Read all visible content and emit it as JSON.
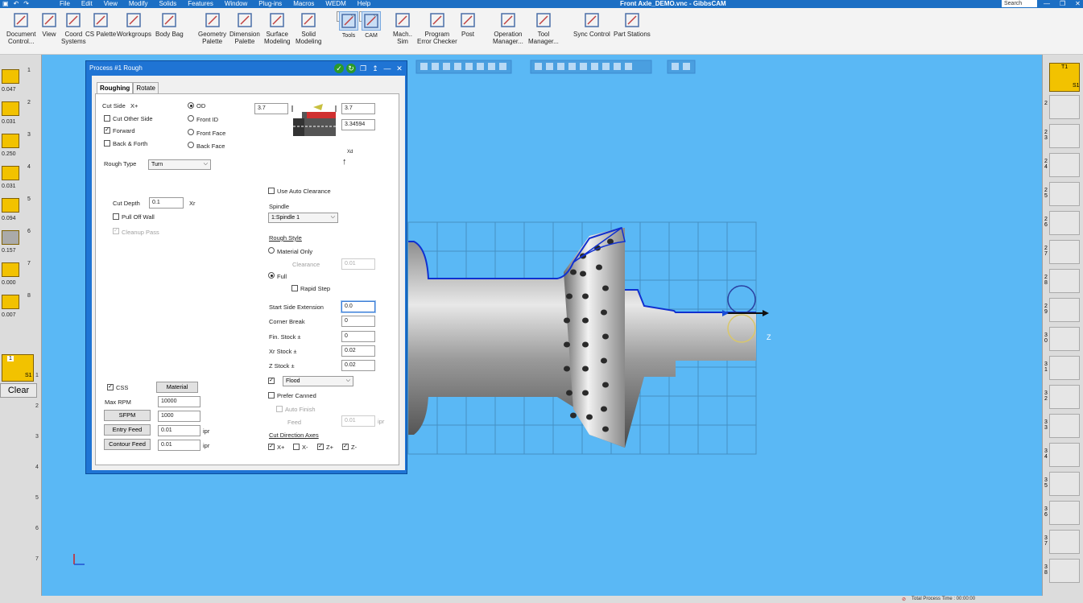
{
  "window": {
    "title": "Front Axle_DEMO.vnc - GibbsCAM",
    "search_placeholder": "Search",
    "menu": [
      "File",
      "Edit",
      "View",
      "Modify",
      "Solids",
      "Features",
      "Window",
      "Plug-ins",
      "Macros",
      "WEDM",
      "Help"
    ]
  },
  "ribbon": {
    "items": [
      {
        "label1": "Document",
        "label2": "Control...",
        "icon": "document-icon"
      },
      {
        "label1": "View",
        "label2": "",
        "icon": "view-icon"
      },
      {
        "label1": "Coord",
        "label2": "Systems",
        "icon": "coord-icon"
      },
      {
        "label1": "CS Palette",
        "label2": "",
        "icon": "cs-palette-icon"
      },
      {
        "label1": "Workgroups",
        "label2": "",
        "icon": "workgroups-icon"
      },
      {
        "label1": "Body Bag",
        "label2": "",
        "icon": "body-bag-icon"
      },
      {
        "label1": "Geometry",
        "label2": "Palette",
        "icon": "geometry-icon"
      },
      {
        "label1": "Dimension",
        "label2": "Palette",
        "icon": "dimension-icon"
      },
      {
        "label1": "Surface",
        "label2": "Modeling",
        "icon": "surface-icon"
      },
      {
        "label1": "Solid",
        "label2": "Modeling",
        "icon": "solid-icon"
      },
      {
        "label1": "Tools",
        "label2": "",
        "icon": "tools-icon"
      },
      {
        "label1": "CAM",
        "label2": "",
        "icon": "cam-icon"
      },
      {
        "label1": "Mach..",
        "label2": "Sim",
        "icon": "machine-sim-icon"
      },
      {
        "label1": "Program",
        "label2": "Error Checker",
        "icon": "check-icon"
      },
      {
        "label1": "Post",
        "label2": "",
        "icon": "post-icon"
      },
      {
        "label1": "Operation",
        "label2": "Manager...",
        "icon": "operation-icon"
      },
      {
        "label1": "Tool",
        "label2": "Manager...",
        "icon": "tool-manager-icon"
      },
      {
        "label1": "Sync Control",
        "label2": "",
        "icon": "sync-icon"
      },
      {
        "label1": "Part Stations",
        "label2": "",
        "icon": "part-stations-icon"
      }
    ]
  },
  "tool_list": {
    "tools": [
      {
        "index": "1",
        "value": "0.047"
      },
      {
        "index": "2",
        "value": "0.031"
      },
      {
        "index": "3",
        "value": "0.250"
      },
      {
        "index": "4",
        "value": "0.031"
      },
      {
        "index": "5",
        "value": "0.094"
      },
      {
        "index": "6",
        "value": "0.157"
      },
      {
        "index": "7",
        "value": "0.000"
      },
      {
        "index": "8",
        "value": "0.007"
      }
    ],
    "clear_label": "Clear",
    "process_tile": {
      "num": "1",
      "sub": "S1"
    },
    "process_slots": [
      "1",
      "2",
      "3",
      "4",
      "5",
      "6",
      "7"
    ]
  },
  "right_stations": {
    "tile_top": "T1",
    "tile_sub": "S1",
    "slots": [
      "2",
      "2 3",
      "2 4",
      "2 5",
      "2 6",
      "2 7",
      "2 8",
      "2 9",
      "3 0",
      "3 1",
      "3 2",
      "3 3",
      "3 4",
      "3 5",
      "3 6",
      "3 7",
      "3 8"
    ]
  },
  "dialog": {
    "title": "Process #1 Rough",
    "tabs": [
      "Roughing",
      "Rotate"
    ],
    "cut_side_label": "Cut Side",
    "cut_side_value": "X+",
    "cut_other_side": "Cut Other Side",
    "forward": "Forward",
    "back_forth": "Back & Forth",
    "od": "OD",
    "front_id": "Front ID",
    "front_face": "Front Face",
    "back_face": "Back Face",
    "dim_left": "3.7",
    "dim_right": "3.7",
    "dim_right2": "3.34594",
    "xd": "Xd",
    "rough_type_label": "Rough Type",
    "rough_type_value": "Turn",
    "use_auto_clearance": "Use Auto Clearance",
    "spindle_label": "Spindle",
    "spindle_value": "1:Spindle 1",
    "cut_depth_label": "Cut Depth",
    "cut_depth_value": "0.1",
    "cut_depth_unit": "Xr",
    "pull_off_wall": "Pull Off Wall",
    "cleanup_pass": "Cleanup Pass",
    "rough_style_label": "Rough Style",
    "material_only": "Material Only",
    "clearance_label": "Clearance",
    "clearance_value": "0.01",
    "full": "Full",
    "rapid_step": "Rapid Step",
    "start_side_ext_label": "Start Side Extension",
    "start_side_ext_value": "0.0",
    "corner_break_label": "Corner Break",
    "corner_break_value": "0",
    "fin_stock_label": "Fin. Stock ±",
    "fin_stock_value": "0",
    "xr_stock_label": "Xr Stock ±",
    "xr_stock_value": "0.02",
    "z_stock_label": "Z Stock ±",
    "z_stock_value": "0.02",
    "css": "CSS",
    "material_btn": "Material",
    "max_rpm_label": "Max RPM",
    "max_rpm_value": "10000",
    "sfpm_btn": "SFPM",
    "sfpm_value": "1000",
    "entry_feed_btn": "Entry Feed",
    "entry_feed_value": "0.01",
    "contour_feed_btn": "Contour Feed",
    "contour_feed_value": "0.01",
    "ipr": "ipr",
    "coolant_value": "Flood",
    "prefer_canned": "Prefer Canned",
    "auto_finish": "Auto Finish",
    "feed_label": "Feed",
    "feed_value": "0.01",
    "cut_dir_label": "Cut Direction Axes",
    "axes": [
      "X+",
      "X-",
      "Z+",
      "Z-"
    ]
  },
  "status": {
    "total_time": "Total Process Time : 00:00:00"
  },
  "colors": {
    "viewport": "#5ab8f5",
    "titlebar": "#1c6fc4",
    "dialog_frame": "#1f74d4"
  }
}
